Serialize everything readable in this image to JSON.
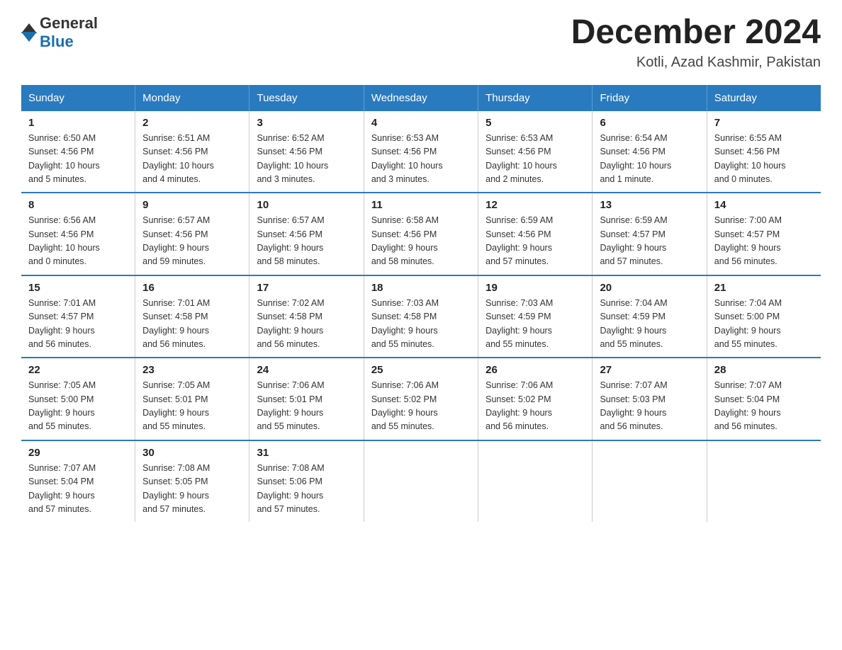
{
  "logo": {
    "text_general": "General",
    "text_blue": "Blue"
  },
  "title": "December 2024",
  "subtitle": "Kotli, Azad Kashmir, Pakistan",
  "days_header": [
    "Sunday",
    "Monday",
    "Tuesday",
    "Wednesday",
    "Thursday",
    "Friday",
    "Saturday"
  ],
  "weeks": [
    [
      {
        "day": "1",
        "sunrise": "6:50 AM",
        "sunset": "4:56 PM",
        "daylight": "10 hours and 5 minutes."
      },
      {
        "day": "2",
        "sunrise": "6:51 AM",
        "sunset": "4:56 PM",
        "daylight": "10 hours and 4 minutes."
      },
      {
        "day": "3",
        "sunrise": "6:52 AM",
        "sunset": "4:56 PM",
        "daylight": "10 hours and 3 minutes."
      },
      {
        "day": "4",
        "sunrise": "6:53 AM",
        "sunset": "4:56 PM",
        "daylight": "10 hours and 3 minutes."
      },
      {
        "day": "5",
        "sunrise": "6:53 AM",
        "sunset": "4:56 PM",
        "daylight": "10 hours and 2 minutes."
      },
      {
        "day": "6",
        "sunrise": "6:54 AM",
        "sunset": "4:56 PM",
        "daylight": "10 hours and 1 minute."
      },
      {
        "day": "7",
        "sunrise": "6:55 AM",
        "sunset": "4:56 PM",
        "daylight": "10 hours and 0 minutes."
      }
    ],
    [
      {
        "day": "8",
        "sunrise": "6:56 AM",
        "sunset": "4:56 PM",
        "daylight": "10 hours and 0 minutes."
      },
      {
        "day": "9",
        "sunrise": "6:57 AM",
        "sunset": "4:56 PM",
        "daylight": "9 hours and 59 minutes."
      },
      {
        "day": "10",
        "sunrise": "6:57 AM",
        "sunset": "4:56 PM",
        "daylight": "9 hours and 58 minutes."
      },
      {
        "day": "11",
        "sunrise": "6:58 AM",
        "sunset": "4:56 PM",
        "daylight": "9 hours and 58 minutes."
      },
      {
        "day": "12",
        "sunrise": "6:59 AM",
        "sunset": "4:56 PM",
        "daylight": "9 hours and 57 minutes."
      },
      {
        "day": "13",
        "sunrise": "6:59 AM",
        "sunset": "4:57 PM",
        "daylight": "9 hours and 57 minutes."
      },
      {
        "day": "14",
        "sunrise": "7:00 AM",
        "sunset": "4:57 PM",
        "daylight": "9 hours and 56 minutes."
      }
    ],
    [
      {
        "day": "15",
        "sunrise": "7:01 AM",
        "sunset": "4:57 PM",
        "daylight": "9 hours and 56 minutes."
      },
      {
        "day": "16",
        "sunrise": "7:01 AM",
        "sunset": "4:58 PM",
        "daylight": "9 hours and 56 minutes."
      },
      {
        "day": "17",
        "sunrise": "7:02 AM",
        "sunset": "4:58 PM",
        "daylight": "9 hours and 56 minutes."
      },
      {
        "day": "18",
        "sunrise": "7:03 AM",
        "sunset": "4:58 PM",
        "daylight": "9 hours and 55 minutes."
      },
      {
        "day": "19",
        "sunrise": "7:03 AM",
        "sunset": "4:59 PM",
        "daylight": "9 hours and 55 minutes."
      },
      {
        "day": "20",
        "sunrise": "7:04 AM",
        "sunset": "4:59 PM",
        "daylight": "9 hours and 55 minutes."
      },
      {
        "day": "21",
        "sunrise": "7:04 AM",
        "sunset": "5:00 PM",
        "daylight": "9 hours and 55 minutes."
      }
    ],
    [
      {
        "day": "22",
        "sunrise": "7:05 AM",
        "sunset": "5:00 PM",
        "daylight": "9 hours and 55 minutes."
      },
      {
        "day": "23",
        "sunrise": "7:05 AM",
        "sunset": "5:01 PM",
        "daylight": "9 hours and 55 minutes."
      },
      {
        "day": "24",
        "sunrise": "7:06 AM",
        "sunset": "5:01 PM",
        "daylight": "9 hours and 55 minutes."
      },
      {
        "day": "25",
        "sunrise": "7:06 AM",
        "sunset": "5:02 PM",
        "daylight": "9 hours and 55 minutes."
      },
      {
        "day": "26",
        "sunrise": "7:06 AM",
        "sunset": "5:02 PM",
        "daylight": "9 hours and 56 minutes."
      },
      {
        "day": "27",
        "sunrise": "7:07 AM",
        "sunset": "5:03 PM",
        "daylight": "9 hours and 56 minutes."
      },
      {
        "day": "28",
        "sunrise": "7:07 AM",
        "sunset": "5:04 PM",
        "daylight": "9 hours and 56 minutes."
      }
    ],
    [
      {
        "day": "29",
        "sunrise": "7:07 AM",
        "sunset": "5:04 PM",
        "daylight": "9 hours and 57 minutes."
      },
      {
        "day": "30",
        "sunrise": "7:08 AM",
        "sunset": "5:05 PM",
        "daylight": "9 hours and 57 minutes."
      },
      {
        "day": "31",
        "sunrise": "7:08 AM",
        "sunset": "5:06 PM",
        "daylight": "9 hours and 57 minutes."
      },
      null,
      null,
      null,
      null
    ]
  ],
  "labels": {
    "sunrise": "Sunrise:",
    "sunset": "Sunset:",
    "daylight": "Daylight:"
  },
  "colors": {
    "header_bg": "#2a7abf",
    "header_text": "#ffffff",
    "border": "#2a7abf"
  }
}
